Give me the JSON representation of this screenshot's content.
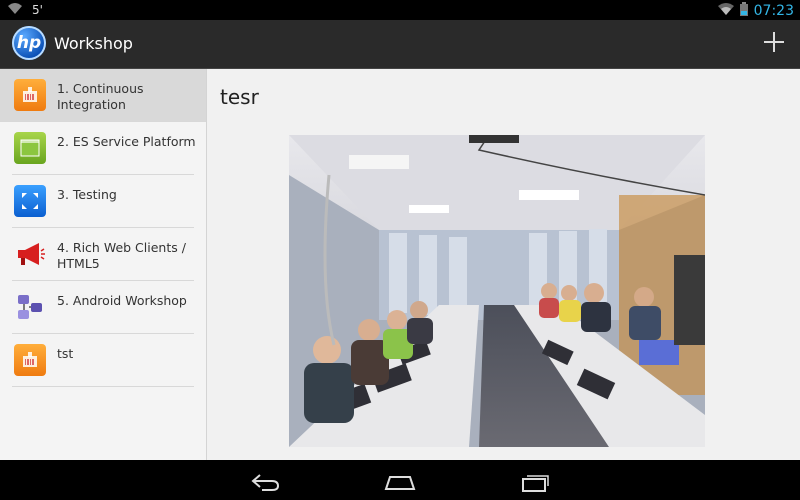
{
  "status_bar": {
    "signal_text": "5'",
    "time": "07:23"
  },
  "action_bar": {
    "logo_text": "hp",
    "title": "Workshop"
  },
  "sidebar": {
    "items": [
      {
        "label": "1. Continuous Integration",
        "icon": "orange-box-icon"
      },
      {
        "label": "2. ES Service Platform",
        "icon": "green-tablet-icon"
      },
      {
        "label": "3. Testing",
        "icon": "blue-expand-icon"
      },
      {
        "label": "4. Rich Web Clients / HTML5",
        "icon": "megaphone-icon"
      },
      {
        "label": "5. Android Workshop",
        "icon": "network-icon"
      },
      {
        "label": "tst",
        "icon": "orange-box-icon"
      }
    ]
  },
  "content": {
    "title": "tesr"
  },
  "colors": {
    "accent": "#33b5e5",
    "action_bar": "#2a2a2a"
  }
}
